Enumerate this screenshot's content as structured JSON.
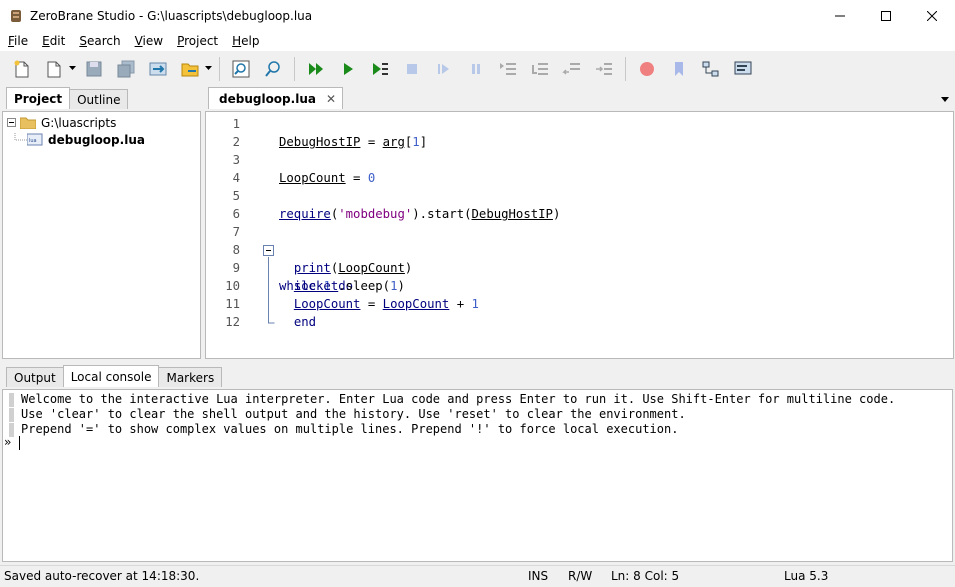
{
  "window": {
    "title": "ZeroBrane Studio - G:\\luascripts\\debugloop.lua"
  },
  "menu": {
    "items": [
      {
        "label": "File",
        "accel": "F",
        "rest": "ile"
      },
      {
        "label": "Edit",
        "accel": "E",
        "rest": "dit"
      },
      {
        "label": "Search",
        "accel": "S",
        "rest": "earch"
      },
      {
        "label": "View",
        "accel": "V",
        "rest": "iew"
      },
      {
        "label": "Project",
        "accel": "P",
        "rest": "roject"
      },
      {
        "label": "Help",
        "accel": "H",
        "rest": "elp"
      }
    ]
  },
  "toolbar": {
    "icons": [
      "new-file-icon",
      "open-file-icon",
      "save-icon",
      "save-all-icon",
      "project-directory-icon",
      "recent-projects-icon",
      "find-icon",
      "replace-in-files-icon",
      "start-debug-icon",
      "run-icon",
      "run-now-icon",
      "stop-icon",
      "step-over-icon",
      "break-icon",
      "step-into-icon",
      "step-out-icon",
      "run-to-cursor-icon",
      "toggle-breakpoint-icon",
      "bookmark-icon",
      "stack-window-icon",
      "watch-window-icon"
    ]
  },
  "leftpanel": {
    "tabs": [
      "Project",
      "Outline"
    ],
    "active_tab": "Project",
    "tree": {
      "root": "G:\\luascripts",
      "children": [
        "debugloop.lua"
      ]
    }
  },
  "editor": {
    "tab_label": "debugloop.lua",
    "close_glyph": "✕",
    "lines": [
      {
        "n": "1",
        "code": ""
      },
      {
        "n": "2",
        "code": "DebugHostIP = arg[1]"
      },
      {
        "n": "3",
        "code": ""
      },
      {
        "n": "4",
        "code": "LoopCount = 0"
      },
      {
        "n": "5",
        "code": ""
      },
      {
        "n": "6",
        "code": "require('mobdebug').start(DebugHostIP)"
      },
      {
        "n": "7",
        "code": ""
      },
      {
        "n": "8",
        "code": "while 1 do"
      },
      {
        "n": "9",
        "code": "  print(LoopCount)"
      },
      {
        "n": "10",
        "code": "  socket.sleep(1)"
      },
      {
        "n": "11",
        "code": "  LoopCount = LoopCount + 1"
      },
      {
        "n": "12",
        "code": "  end"
      }
    ]
  },
  "bottompanel": {
    "tabs": [
      "Output",
      "Local console",
      "Markers"
    ],
    "active_tab": "Local console",
    "console_lines": [
      "Welcome to the interactive Lua interpreter. Enter Lua code and press Enter to run it. Use Shift-Enter for multiline code.",
      "Use 'clear' to clear the shell output and the history. Use 'reset' to clear the environment.",
      "Prepend '=' to show complex values on multiple lines. Prepend '!' to force local execution."
    ],
    "prompt": "»"
  },
  "statusbar": {
    "message": "Saved auto-recover at 14:18:30.",
    "mode": "INS",
    "access": "R/W",
    "position": "Ln: 8 Col: 5",
    "interpreter": "Lua 5.3"
  },
  "colors": {
    "keyword": "#00007f",
    "number": "#3f5fc8",
    "string": "#800080"
  }
}
